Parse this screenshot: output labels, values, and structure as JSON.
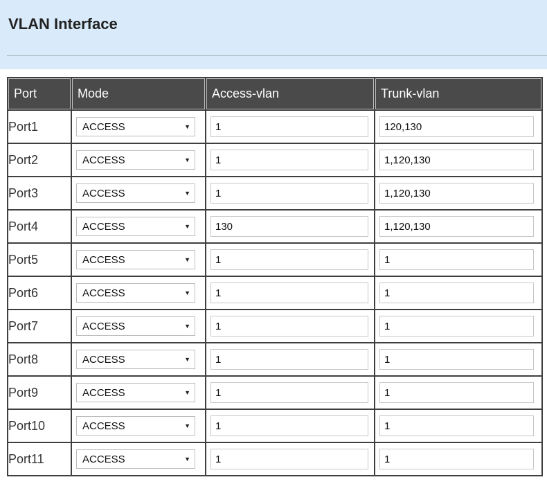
{
  "page": {
    "title": "VLAN Interface"
  },
  "table": {
    "headers": [
      "Port",
      "Mode",
      "Access-vlan",
      "Trunk-vlan"
    ],
    "rows": [
      {
        "port": "Port1",
        "mode": "ACCESS",
        "access_vlan": "1",
        "trunk_vlan": "120,130"
      },
      {
        "port": "Port2",
        "mode": "ACCESS",
        "access_vlan": "1",
        "trunk_vlan": "1,120,130"
      },
      {
        "port": "Port3",
        "mode": "ACCESS",
        "access_vlan": "1",
        "trunk_vlan": "1,120,130"
      },
      {
        "port": "Port4",
        "mode": "ACCESS",
        "access_vlan": "130",
        "trunk_vlan": "1,120,130"
      },
      {
        "port": "Port5",
        "mode": "ACCESS",
        "access_vlan": "1",
        "trunk_vlan": "1"
      },
      {
        "port": "Port6",
        "mode": "ACCESS",
        "access_vlan": "1",
        "trunk_vlan": "1"
      },
      {
        "port": "Port7",
        "mode": "ACCESS",
        "access_vlan": "1",
        "trunk_vlan": "1"
      },
      {
        "port": "Port8",
        "mode": "ACCESS",
        "access_vlan": "1",
        "trunk_vlan": "1"
      },
      {
        "port": "Port9",
        "mode": "ACCESS",
        "access_vlan": "1",
        "trunk_vlan": "1"
      },
      {
        "port": "Port10",
        "mode": "ACCESS",
        "access_vlan": "1",
        "trunk_vlan": "1"
      },
      {
        "port": "Port11",
        "mode": "ACCESS",
        "access_vlan": "1",
        "trunk_vlan": "1"
      }
    ]
  },
  "icons": {
    "dropdown": "triangle-down-icon"
  },
  "colors": {
    "header_band": "#d9ebfa",
    "table_header": "#4a4a4a"
  }
}
